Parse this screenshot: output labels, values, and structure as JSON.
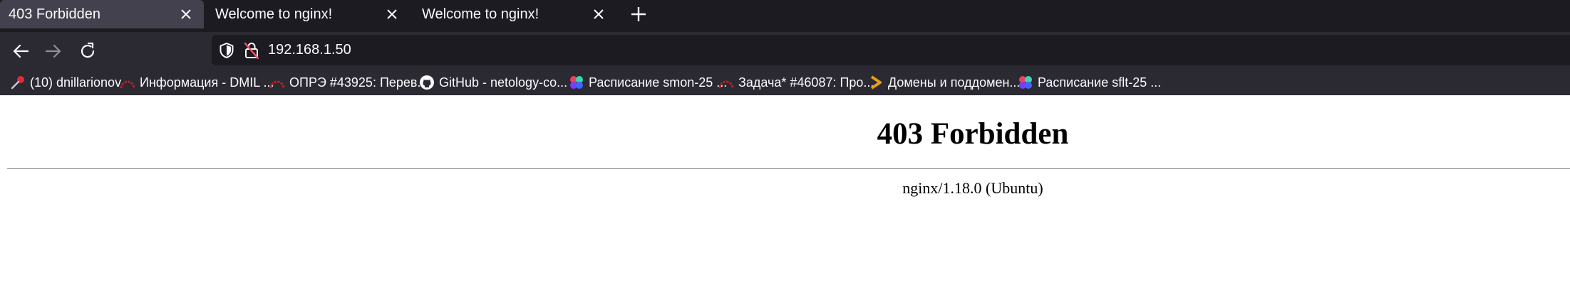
{
  "tabs": [
    {
      "title": "403 Forbidden",
      "active": true
    },
    {
      "title": "Welcome to nginx!",
      "active": false
    },
    {
      "title": "Welcome to nginx!",
      "active": false
    }
  ],
  "toolbar": {
    "url": "192.168.1.50"
  },
  "bookmarks": [
    {
      "label": "(10) dnillarionov",
      "icon": "pin-icon"
    },
    {
      "label": "Информация - DMIL ...",
      "icon": "redmine-icon"
    },
    {
      "label": "ОПРЭ #43925: Перев...",
      "icon": "redmine-icon"
    },
    {
      "label": "GitHub - netology-co...",
      "icon": "github-icon"
    },
    {
      "label": "Расписание smon-25 ...",
      "icon": "netology-icon"
    },
    {
      "label": "Задача* #46087: Про...",
      "icon": "redmine-icon"
    },
    {
      "label": "Домены и поддомен...",
      "icon": "chevron-icon"
    },
    {
      "label": "Расписание sflt-25 ...",
      "icon": "netology-icon"
    }
  ],
  "page": {
    "heading": "403 Forbidden",
    "server": "nginx/1.18.0 (Ubuntu)"
  },
  "colors": {
    "tabstrip_bg": "#1c1b22",
    "toolbar_bg": "#2b2a33",
    "active_tab_bg": "#42414d",
    "text_light": "#fbfbfe",
    "redmine_red": "#b32024",
    "plex_yellow": "#e5a00d"
  }
}
